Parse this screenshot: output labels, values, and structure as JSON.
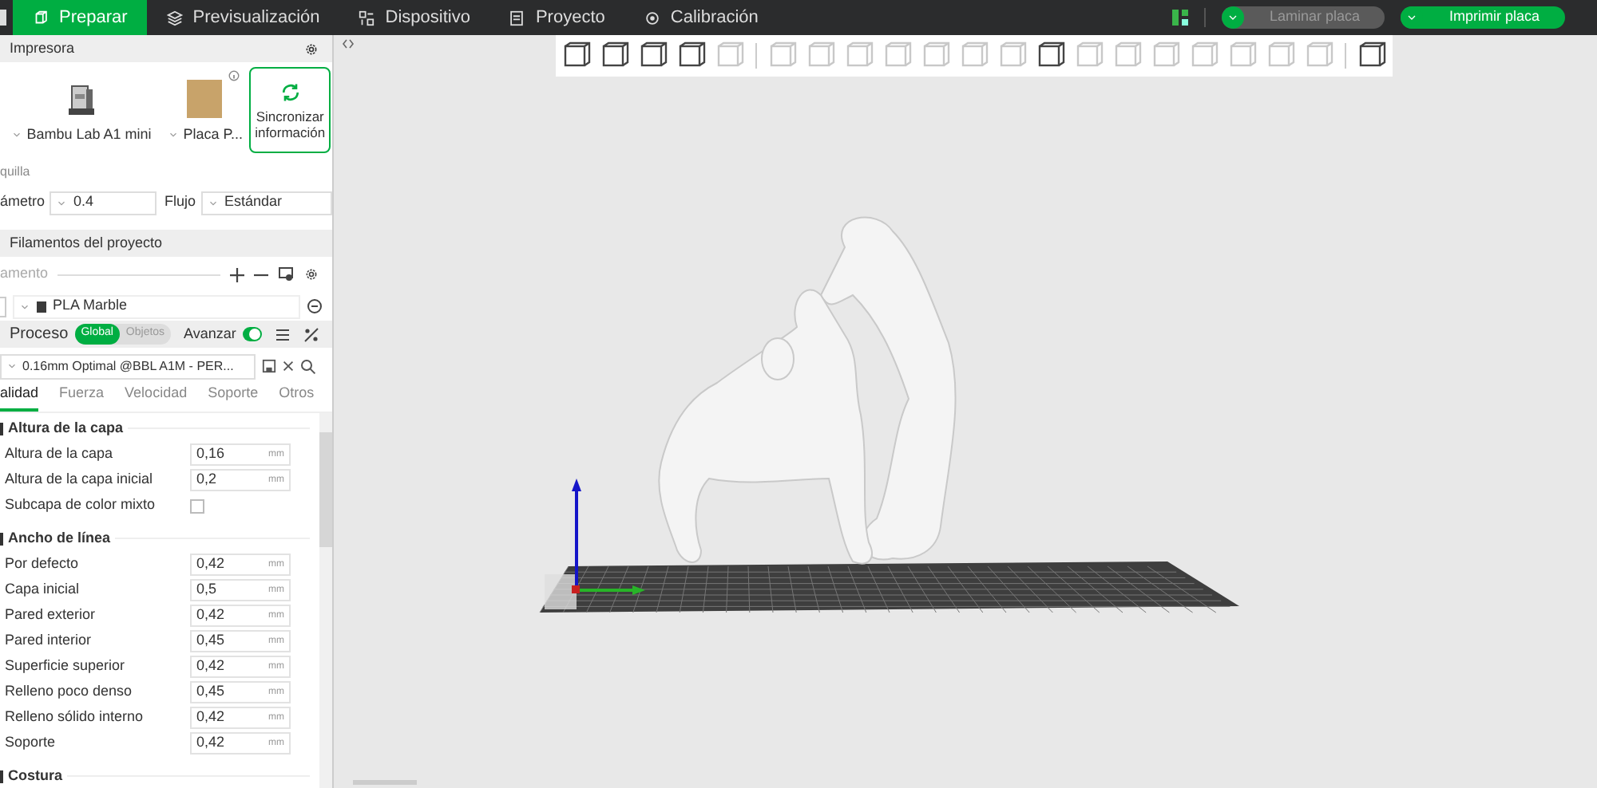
{
  "top_bar": {
    "tabs": [
      {
        "label": "Preparar",
        "selected": true
      },
      {
        "label": "Previsualización",
        "selected": false
      },
      {
        "label": "Dispositivo",
        "selected": false
      },
      {
        "label": "Proyecto",
        "selected": false
      },
      {
        "label": "Calibración",
        "selected": false
      }
    ],
    "slice_button": {
      "label": "Laminar placa",
      "disabled": true
    },
    "print_button": {
      "label": "Imprimir placa",
      "disabled": false
    }
  },
  "printer": {
    "title": "Impresora",
    "printer_name": "Bambu Lab A1 mini",
    "plate_name": "Placa P...",
    "sync_button": "Sincronizar información"
  },
  "nozzle": {
    "title": "quilla",
    "diameter_label": "ámetro",
    "diameter": "0.4",
    "flow_label": "Flujo",
    "flow": "Estándar"
  },
  "filaments": {
    "title": "Filamentos del proyecto",
    "subtitle": "amento",
    "items": [
      {
        "name": "PLA Marble",
        "color": "#3a3a3a"
      }
    ]
  },
  "process": {
    "title": "Proceso",
    "scopes": [
      {
        "label": "Global",
        "selected": true
      },
      {
        "label": "Objetos",
        "selected": false
      }
    ],
    "advanced_label": "Avanzar",
    "advanced_on": true,
    "preset": "0.16mm Optimal @BBL A1M - PER...",
    "tabs": [
      {
        "label": "alidad",
        "selected": true
      },
      {
        "label": "Fuerza",
        "selected": false
      },
      {
        "label": "Velocidad",
        "selected": false
      },
      {
        "label": "Soporte",
        "selected": false
      },
      {
        "label": "Otros",
        "selected": false
      }
    ],
    "groups": [
      {
        "title": "Altura de la capa",
        "settings": [
          {
            "kind": "number",
            "label": "Altura de la capa",
            "value": "0,16",
            "unit": "mm"
          },
          {
            "kind": "number",
            "label": "Altura de la capa inicial",
            "value": "0,2",
            "unit": "mm"
          },
          {
            "kind": "checkbox",
            "label": "Subcapa de color mixto",
            "checked": false
          }
        ]
      },
      {
        "title": "Ancho de línea",
        "settings": [
          {
            "kind": "number",
            "label": "Por defecto",
            "value": "0,42",
            "unit": "mm"
          },
          {
            "kind": "number",
            "label": "Capa inicial",
            "value": "0,5",
            "unit": "mm"
          },
          {
            "kind": "number",
            "label": "Pared exterior",
            "value": "0,42",
            "unit": "mm"
          },
          {
            "kind": "number",
            "label": "Pared interior",
            "value": "0,45",
            "unit": "mm"
          },
          {
            "kind": "number",
            "label": "Superficie superior",
            "value": "0,42",
            "unit": "mm"
          },
          {
            "kind": "number",
            "label": "Relleno poco denso",
            "value": "0,45",
            "unit": "mm"
          },
          {
            "kind": "number",
            "label": "Relleno sólido interno",
            "value": "0,42",
            "unit": "mm"
          },
          {
            "kind": "number",
            "label": "Soporte",
            "value": "0,42",
            "unit": "mm"
          }
        ]
      },
      {
        "title": "Costura"
      }
    ]
  }
}
